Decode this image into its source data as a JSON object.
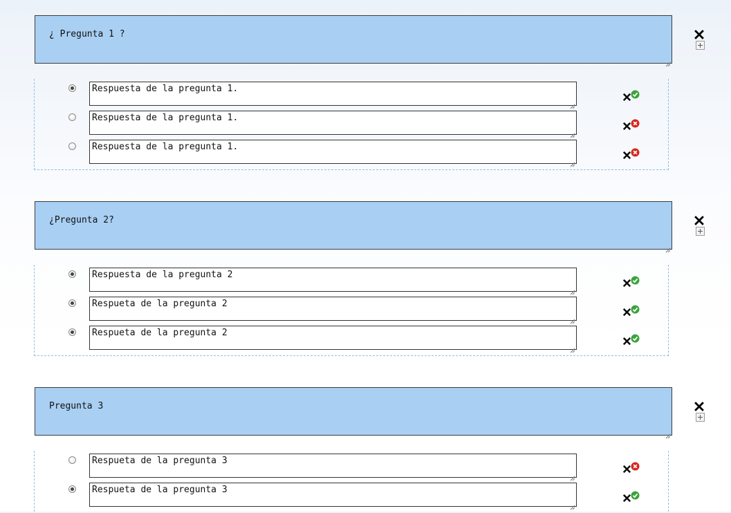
{
  "questions": [
    {
      "text": "¿ Pregunta 1 ?",
      "answers": [
        {
          "text": "Respuesta de la pregunta 1.",
          "selected": true,
          "status": "correct"
        },
        {
          "text": "Respuesta de la pregunta 1.",
          "selected": false,
          "status": "incorrect"
        },
        {
          "text": "Respuesta de la pregunta 1.",
          "selected": false,
          "status": "incorrect"
        }
      ]
    },
    {
      "text": "¿Pregunta 2?",
      "answers": [
        {
          "text": "Respuesta de la pregunta 2",
          "selected": true,
          "status": "correct"
        },
        {
          "text": "Respueta de la pregunta 2",
          "selected": true,
          "status": "correct"
        },
        {
          "text": "Respueta de la pregunta 2",
          "selected": true,
          "status": "correct"
        }
      ]
    },
    {
      "text": "Pregunta 3",
      "answers": [
        {
          "text": "Respueta de la pregunta 3",
          "selected": false,
          "status": "incorrect"
        },
        {
          "text": "Respueta de la pregunta 3",
          "selected": true,
          "status": "correct"
        }
      ]
    }
  ],
  "icons": {
    "delete_question": "close-icon",
    "add_answer": "plus-box-icon",
    "delete_answer": "close-icon",
    "correct": "check-circle-icon",
    "incorrect": "x-circle-icon"
  },
  "colors": {
    "question_bg": "#a9cff3",
    "answers_border": "#8cbde8",
    "correct": "#3aa33a",
    "incorrect": "#d9261c"
  }
}
